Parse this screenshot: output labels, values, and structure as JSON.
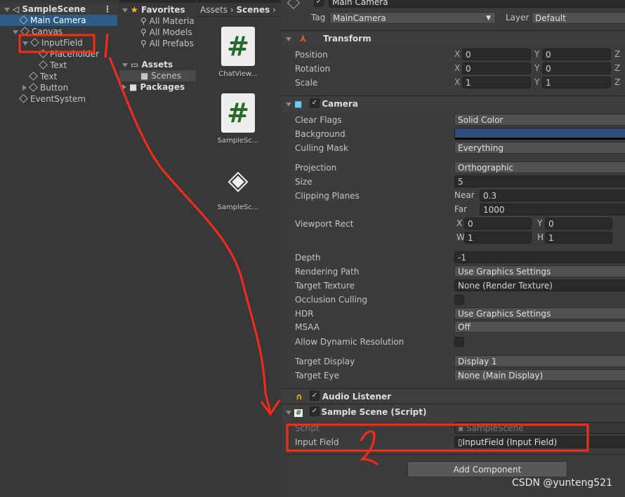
{
  "hierarchy": {
    "scene": "SampleScene",
    "items": [
      {
        "label": "Main Camera",
        "depth": 1,
        "selected": true,
        "fold": ""
      },
      {
        "label": "Canvas",
        "depth": 1,
        "fold": "open"
      },
      {
        "label": "InputField",
        "depth": 2,
        "fold": "open"
      },
      {
        "label": "Placeholder",
        "depth": 3,
        "fold": ""
      },
      {
        "label": "Text",
        "depth": 3,
        "fold": ""
      },
      {
        "label": "Text",
        "depth": 2,
        "fold": ""
      },
      {
        "label": "Button",
        "depth": 2,
        "fold": "closed"
      },
      {
        "label": "EventSystem",
        "depth": 1,
        "fold": ""
      }
    ]
  },
  "project": {
    "favorites": "Favorites",
    "fav_items": [
      "All Materia",
      "All Models",
      "All Prefabs"
    ],
    "assets": "Assets",
    "scenes": "Scenes",
    "packages": "Packages"
  },
  "breadcrumb": [
    "Assets",
    "Scenes"
  ],
  "assets": [
    {
      "name": "ChatView...",
      "type": "script"
    },
    {
      "name": "SampleSc...",
      "type": "script"
    },
    {
      "name": "SampleSc...",
      "type": "unity"
    }
  ],
  "inspector": {
    "object_name": "Main Camera",
    "tag_label": "Tag",
    "tag": "MainCamera",
    "layer_label": "Layer",
    "layer": "Default",
    "transform": {
      "title": "Transform",
      "rows": [
        {
          "label": "Position",
          "x": "0",
          "y": "0"
        },
        {
          "label": "Rotation",
          "x": "0",
          "y": "0"
        },
        {
          "label": "Scale",
          "x": "1",
          "y": "1"
        }
      ]
    },
    "camera": {
      "title": "Camera",
      "rows": [
        {
          "label": "Clear Flags",
          "value": "Solid Color",
          "kind": "drop"
        },
        {
          "label": "Background",
          "value": "",
          "kind": "color",
          "color": "#314d79"
        },
        {
          "label": "Culling Mask",
          "value": "Everything",
          "kind": "drop"
        },
        {
          "label": "Projection",
          "value": "Orthographic",
          "kind": "drop"
        },
        {
          "label": "Size",
          "value": "5",
          "kind": "field"
        },
        {
          "label": "Clipping Planes",
          "sub": "Near",
          "value": "0.3",
          "kind": "sub"
        },
        {
          "label": "",
          "sub": "Far",
          "value": "1000",
          "kind": "sub"
        },
        {
          "label": "Viewport Rect",
          "a": "X",
          "av": "0",
          "b": "Y",
          "bv": "0",
          "kind": "pair"
        },
        {
          "label": "",
          "a": "W",
          "av": "1",
          "b": "H",
          "bv": "1",
          "kind": "pair"
        },
        {
          "label": "Depth",
          "value": "-1",
          "kind": "field"
        },
        {
          "label": "Rendering Path",
          "value": "Use Graphics Settings",
          "kind": "drop"
        },
        {
          "label": "Target Texture",
          "value": "None (Render Texture)",
          "kind": "field"
        },
        {
          "label": "Occlusion Culling",
          "kind": "check"
        },
        {
          "label": "HDR",
          "value": "Use Graphics Settings",
          "kind": "drop"
        },
        {
          "label": "MSAA",
          "value": "Off",
          "kind": "drop"
        },
        {
          "label": "Allow Dynamic Resolution",
          "kind": "check"
        },
        {
          "label": "Target Display",
          "value": "Display 1",
          "kind": "drop"
        },
        {
          "label": "Target Eye",
          "value": "None (Main Display)",
          "kind": "drop"
        }
      ]
    },
    "audio_listener": {
      "title": "Audio Listener"
    },
    "script": {
      "title": "Sample Scene (Script)",
      "script_label": "Script",
      "script_value": "SampleScene",
      "input_label": "Input Field",
      "input_value": "InputField (Input Field)"
    },
    "add_component": "Add Component"
  },
  "annotations": {
    "number": "2",
    "color": "#ff2a1a"
  },
  "watermark": "CSDN @yunteng521"
}
